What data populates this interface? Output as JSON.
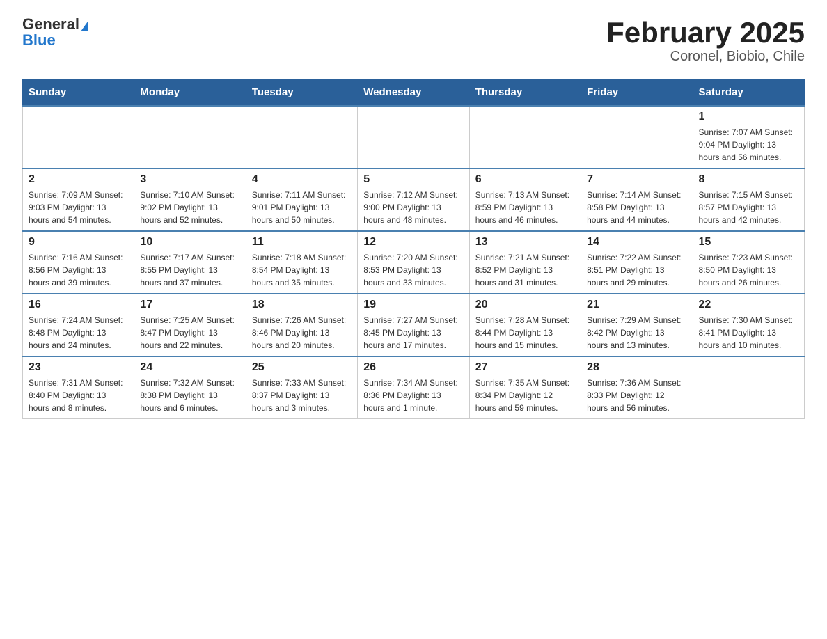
{
  "header": {
    "logo_general": "General",
    "logo_blue": "Blue",
    "title": "February 2025",
    "subtitle": "Coronel, Biobio, Chile"
  },
  "weekdays": [
    "Sunday",
    "Monday",
    "Tuesday",
    "Wednesday",
    "Thursday",
    "Friday",
    "Saturday"
  ],
  "weeks": [
    [
      {
        "day": "",
        "info": ""
      },
      {
        "day": "",
        "info": ""
      },
      {
        "day": "",
        "info": ""
      },
      {
        "day": "",
        "info": ""
      },
      {
        "day": "",
        "info": ""
      },
      {
        "day": "",
        "info": ""
      },
      {
        "day": "1",
        "info": "Sunrise: 7:07 AM\nSunset: 9:04 PM\nDaylight: 13 hours and 56 minutes."
      }
    ],
    [
      {
        "day": "2",
        "info": "Sunrise: 7:09 AM\nSunset: 9:03 PM\nDaylight: 13 hours and 54 minutes."
      },
      {
        "day": "3",
        "info": "Sunrise: 7:10 AM\nSunset: 9:02 PM\nDaylight: 13 hours and 52 minutes."
      },
      {
        "day": "4",
        "info": "Sunrise: 7:11 AM\nSunset: 9:01 PM\nDaylight: 13 hours and 50 minutes."
      },
      {
        "day": "5",
        "info": "Sunrise: 7:12 AM\nSunset: 9:00 PM\nDaylight: 13 hours and 48 minutes."
      },
      {
        "day": "6",
        "info": "Sunrise: 7:13 AM\nSunset: 8:59 PM\nDaylight: 13 hours and 46 minutes."
      },
      {
        "day": "7",
        "info": "Sunrise: 7:14 AM\nSunset: 8:58 PM\nDaylight: 13 hours and 44 minutes."
      },
      {
        "day": "8",
        "info": "Sunrise: 7:15 AM\nSunset: 8:57 PM\nDaylight: 13 hours and 42 minutes."
      }
    ],
    [
      {
        "day": "9",
        "info": "Sunrise: 7:16 AM\nSunset: 8:56 PM\nDaylight: 13 hours and 39 minutes."
      },
      {
        "day": "10",
        "info": "Sunrise: 7:17 AM\nSunset: 8:55 PM\nDaylight: 13 hours and 37 minutes."
      },
      {
        "day": "11",
        "info": "Sunrise: 7:18 AM\nSunset: 8:54 PM\nDaylight: 13 hours and 35 minutes."
      },
      {
        "day": "12",
        "info": "Sunrise: 7:20 AM\nSunset: 8:53 PM\nDaylight: 13 hours and 33 minutes."
      },
      {
        "day": "13",
        "info": "Sunrise: 7:21 AM\nSunset: 8:52 PM\nDaylight: 13 hours and 31 minutes."
      },
      {
        "day": "14",
        "info": "Sunrise: 7:22 AM\nSunset: 8:51 PM\nDaylight: 13 hours and 29 minutes."
      },
      {
        "day": "15",
        "info": "Sunrise: 7:23 AM\nSunset: 8:50 PM\nDaylight: 13 hours and 26 minutes."
      }
    ],
    [
      {
        "day": "16",
        "info": "Sunrise: 7:24 AM\nSunset: 8:48 PM\nDaylight: 13 hours and 24 minutes."
      },
      {
        "day": "17",
        "info": "Sunrise: 7:25 AM\nSunset: 8:47 PM\nDaylight: 13 hours and 22 minutes."
      },
      {
        "day": "18",
        "info": "Sunrise: 7:26 AM\nSunset: 8:46 PM\nDaylight: 13 hours and 20 minutes."
      },
      {
        "day": "19",
        "info": "Sunrise: 7:27 AM\nSunset: 8:45 PM\nDaylight: 13 hours and 17 minutes."
      },
      {
        "day": "20",
        "info": "Sunrise: 7:28 AM\nSunset: 8:44 PM\nDaylight: 13 hours and 15 minutes."
      },
      {
        "day": "21",
        "info": "Sunrise: 7:29 AM\nSunset: 8:42 PM\nDaylight: 13 hours and 13 minutes."
      },
      {
        "day": "22",
        "info": "Sunrise: 7:30 AM\nSunset: 8:41 PM\nDaylight: 13 hours and 10 minutes."
      }
    ],
    [
      {
        "day": "23",
        "info": "Sunrise: 7:31 AM\nSunset: 8:40 PM\nDaylight: 13 hours and 8 minutes."
      },
      {
        "day": "24",
        "info": "Sunrise: 7:32 AM\nSunset: 8:38 PM\nDaylight: 13 hours and 6 minutes."
      },
      {
        "day": "25",
        "info": "Sunrise: 7:33 AM\nSunset: 8:37 PM\nDaylight: 13 hours and 3 minutes."
      },
      {
        "day": "26",
        "info": "Sunrise: 7:34 AM\nSunset: 8:36 PM\nDaylight: 13 hours and 1 minute."
      },
      {
        "day": "27",
        "info": "Sunrise: 7:35 AM\nSunset: 8:34 PM\nDaylight: 12 hours and 59 minutes."
      },
      {
        "day": "28",
        "info": "Sunrise: 7:36 AM\nSunset: 8:33 PM\nDaylight: 12 hours and 56 minutes."
      },
      {
        "day": "",
        "info": ""
      }
    ]
  ]
}
